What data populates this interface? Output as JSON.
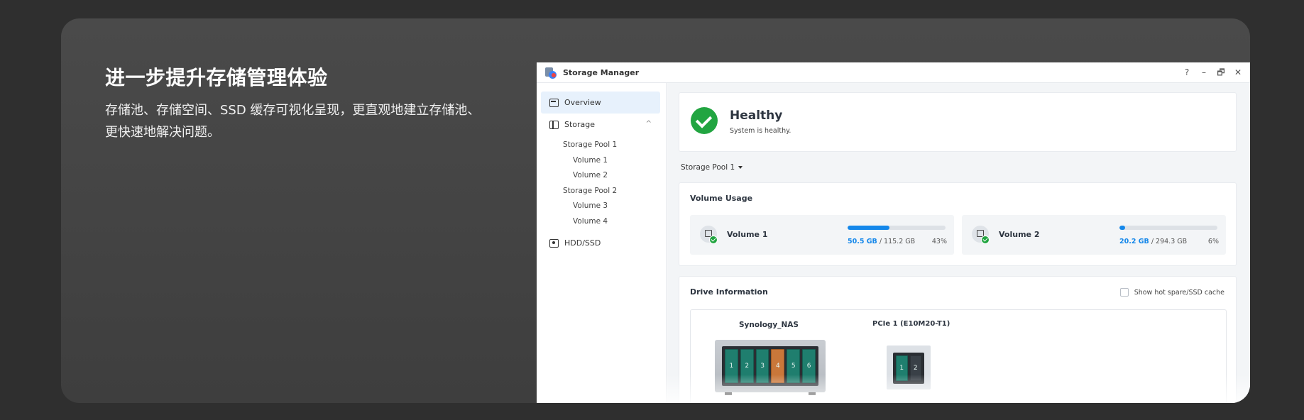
{
  "promo": {
    "heading": "进一步提升存储管理体验",
    "description": "存储池、存储空间、SSD 缓存可视化呈现，更直观地建立存储池、更快速地解决问题。"
  },
  "window": {
    "title": "Storage Manager",
    "controls": [
      "?",
      "–",
      "🗗",
      "✕"
    ]
  },
  "sidebar": {
    "overview": "Overview",
    "storage": "Storage",
    "pools": [
      {
        "name": "Storage Pool 1",
        "volumes": [
          "Volume 1",
          "Volume 2"
        ]
      },
      {
        "name": "Storage Pool 2",
        "volumes": [
          "Volume 3",
          "Volume 4"
        ]
      }
    ],
    "hdd": "HDD/SSD"
  },
  "health": {
    "status": "Healthy",
    "message": "System is healthy."
  },
  "pool_selector": "Storage Pool 1",
  "volume_usage": {
    "title": "Volume Usage",
    "volumes": [
      {
        "name": "Volume 1",
        "used": "50.5 GB",
        "total": "/ 115.2 GB",
        "percent": "43%",
        "fraction": 0.43
      },
      {
        "name": "Volume 2",
        "used": "20.2 GB",
        "total": "/ 294.3 GB",
        "percent": "6%",
        "fraction": 0.06
      }
    ]
  },
  "drive_info": {
    "title": "Drive Information",
    "hotspare_label": "Show hot spare/SSD cache",
    "devices": [
      {
        "name": "Synology_NAS",
        "bays": [
          "1",
          "2",
          "3",
          "4",
          "5",
          "6"
        ]
      },
      {
        "name": "PCIe 1 (E10M20-T1)",
        "bays": [
          "1",
          "2"
        ]
      }
    ]
  },
  "colors": {
    "accent": "#1487ea",
    "healthy": "#22a541",
    "bay_green": "#1f7e6e",
    "bay_orange": "#c9773a"
  }
}
